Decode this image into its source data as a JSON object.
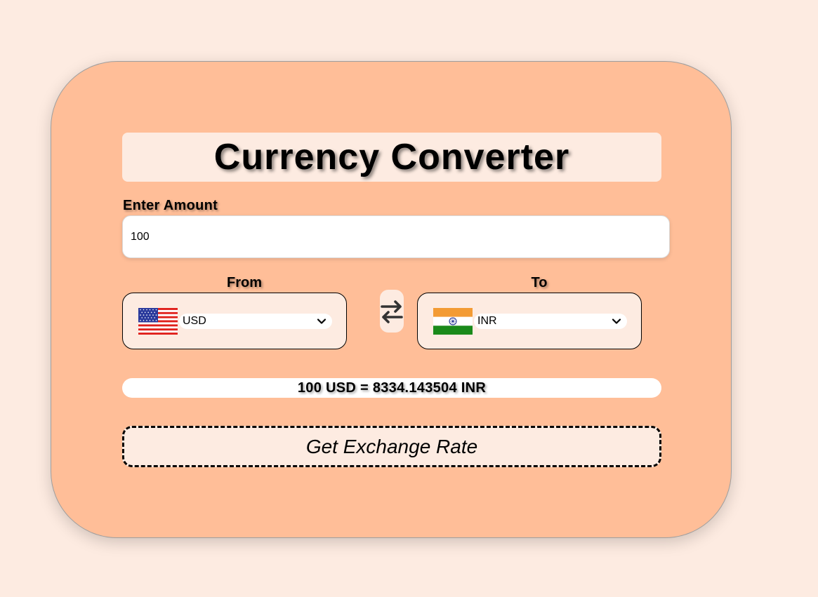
{
  "app": {
    "title": "Currency Converter"
  },
  "amount": {
    "label": "Enter Amount",
    "value": "100"
  },
  "from": {
    "label": "From",
    "currency": "USD",
    "flag": "us-flag-icon"
  },
  "to": {
    "label": "To",
    "currency": "INR",
    "flag": "india-flag-icon"
  },
  "swap": {
    "icon": "swap-arrows-icon"
  },
  "result": {
    "text": "100 USD = 8334.143504 INR"
  },
  "action": {
    "button_label": "Get Exchange Rate"
  },
  "colors": {
    "page_background": "#fdebe1",
    "card_background": "#ffbe98",
    "panel_background": "#fdebe1"
  }
}
